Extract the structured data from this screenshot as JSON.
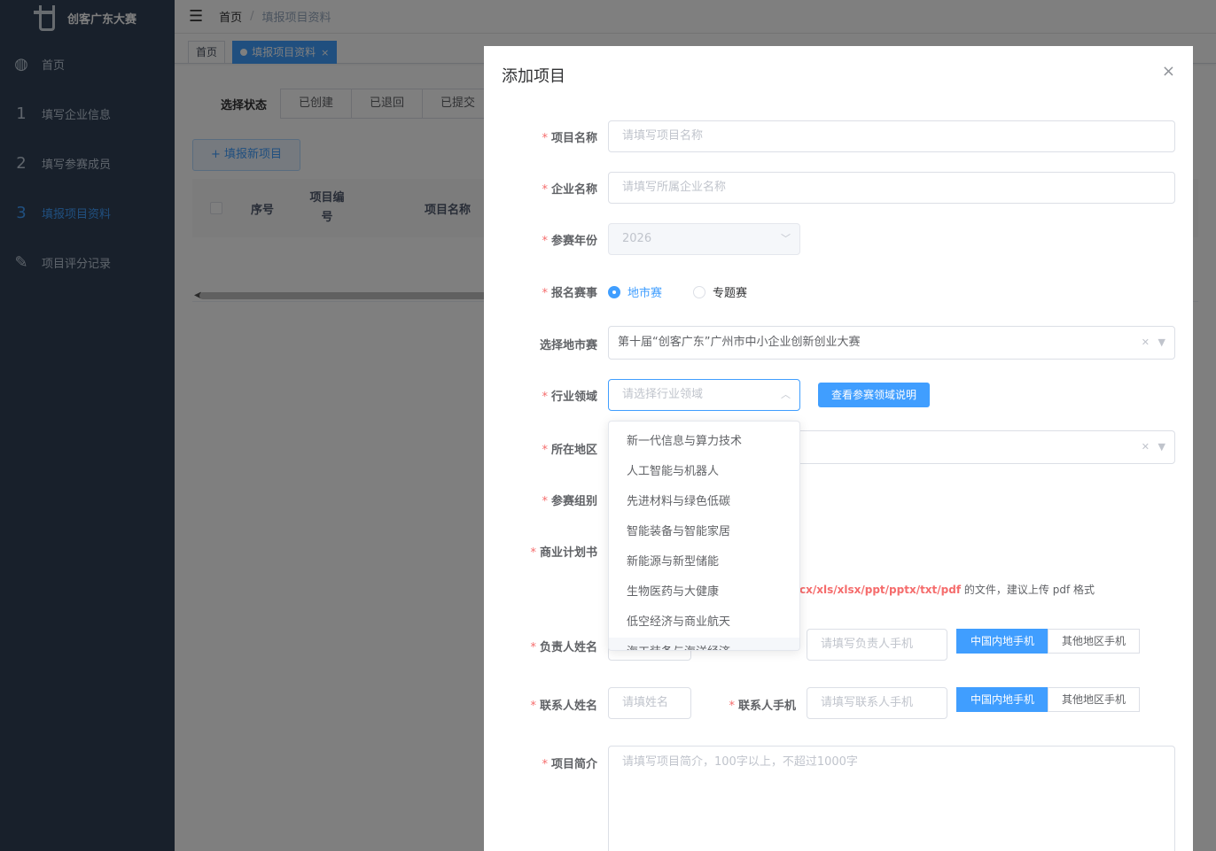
{
  "app": {
    "logo_text": "创客广东大赛"
  },
  "sidebar": {
    "items": [
      {
        "icon": "dashboard-icon",
        "glyph": "◍",
        "label": "首页"
      },
      {
        "icon": "step-one-icon",
        "glyph": "1",
        "label": "填写企业信息"
      },
      {
        "icon": "step-two-icon",
        "glyph": "2",
        "label": "填写参赛成员"
      },
      {
        "icon": "step-three-icon",
        "glyph": "3",
        "label": "填报项目资料"
      },
      {
        "icon": "edit-icon",
        "glyph": "✎",
        "label": "项目评分记录"
      }
    ]
  },
  "navbar": {
    "breadcrumb_home": "首页",
    "breadcrumb_separator": "/",
    "breadcrumb_current": "填报项目资料"
  },
  "tags": {
    "home": "首页",
    "current": "填报项目资料",
    "close": "×"
  },
  "filter": {
    "label": "选择状态",
    "options": [
      "已创建",
      "已退回",
      "已提交"
    ]
  },
  "toolbar": {
    "add_label": "+ 填报新项目"
  },
  "table": {
    "headers": {
      "seq": "序号",
      "code": "项目编号",
      "name": "项目名称"
    }
  },
  "dialog": {
    "title": "添加项目",
    "close": "×",
    "fields": {
      "project_name": {
        "label": "项目名称",
        "placeholder": "请填写项目名称"
      },
      "company_name": {
        "label": "企业名称",
        "placeholder": "请填写所属企业名称"
      },
      "year": {
        "label": "参赛年份",
        "value": "2026"
      },
      "competition": {
        "label": "报名赛事",
        "options": [
          "地市赛",
          "专题赛"
        ],
        "selected": "地市赛"
      },
      "city_contest": {
        "label": "选择地市赛",
        "value": "第十届“创客广东”广州市中小企业创新创业大赛"
      },
      "industry": {
        "label": "行业领域",
        "placeholder": "请选择行业领域",
        "help_button": "查看参赛领域说明"
      },
      "region": {
        "label": "所在地区"
      },
      "group": {
        "label": "参赛组别"
      },
      "business_plan": {
        "label": "商业计划书",
        "hint_types": "cx/xls/xlsx/ppt/pptx/txt/pdf",
        "hint_rest": " 的文件，建议上传 pdf 格式"
      },
      "leader": {
        "label": "负责人姓名",
        "phone_placeholder": "请填写负责人手机"
      },
      "contact": {
        "label": "联系人姓名",
        "name_placeholder": "请填姓名",
        "phone_label": "联系人手机",
        "phone_placeholder": "请填写联系人手机"
      },
      "phone_options": [
        "中国内地手机",
        "其他地区手机"
      ],
      "intro": {
        "label": "项目简介",
        "placeholder": "请填写项目简介，100字以上，不超过1000字"
      }
    },
    "industry_options": [
      "新一代信息与算力技术",
      "人工智能与机器人",
      "先进材料与绿色低碳",
      "智能装备与智能家居",
      "新能源与新型储能",
      "生物医药与大健康",
      "低空经济与商业航天",
      "海工装备与海洋经济"
    ]
  },
  "colors": {
    "primary": "#409eff",
    "sidebar_bg": "#304156",
    "required": "#f56c6c"
  }
}
